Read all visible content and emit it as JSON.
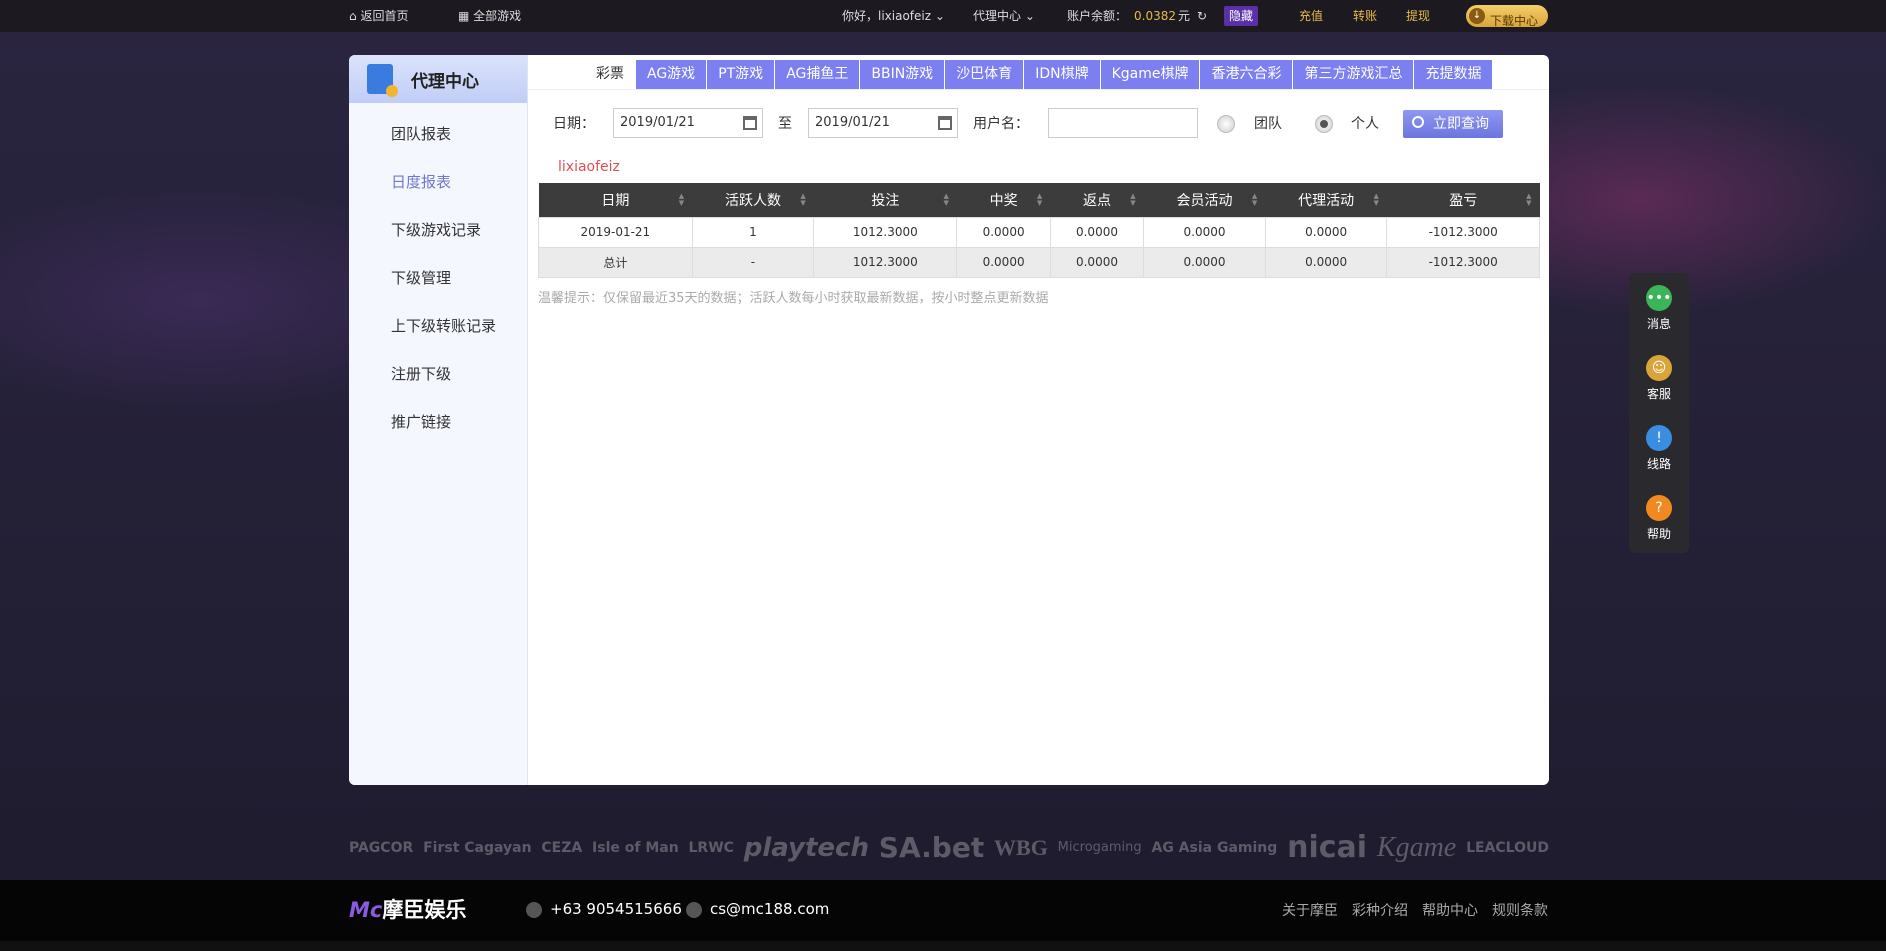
{
  "topbar": {
    "home": "返回首页",
    "all_games": "全部游戏",
    "greeting": "你好，lixiaofeiz",
    "agent_center": "代理中心",
    "balance_label": "账户余额：",
    "balance": "0.0382",
    "currency": "元",
    "hide": "隐藏",
    "deposit": "充值",
    "transfer": "转账",
    "withdraw": "提现",
    "download": "下载中心"
  },
  "sidebar": {
    "title": "代理中心",
    "items": [
      "团队报表",
      "日度报表",
      "下级游戏记录",
      "下级管理",
      "上下级转账记录",
      "注册下级",
      "推广链接"
    ]
  },
  "tabs": [
    "彩票",
    "AG游戏",
    "PT游戏",
    "AG捕鱼王",
    "BBIN游戏",
    "沙巴体育",
    "IDN棋牌",
    "Kgame棋牌",
    "香港六合彩",
    "第三方游戏汇总",
    "充提数据"
  ],
  "form": {
    "date_label": "日期：",
    "start": "2019/01/21",
    "to": "至",
    "end": "2019/01/21",
    "user_label": "用户名：",
    "user_value": "",
    "team": "团队",
    "personal": "个人",
    "query": "立即查询"
  },
  "username": "lixiaofeiz",
  "table": {
    "headers": [
      "日期",
      "活跃人数",
      "投注",
      "中奖",
      "返点",
      "会员活动",
      "代理活动",
      "盈亏"
    ],
    "rows": [
      [
        "2019-01-21",
        "1",
        "1012.3000",
        "0.0000",
        "0.0000",
        "0.0000",
        "0.0000",
        "-1012.3000"
      ],
      [
        "总计",
        "-",
        "1012.3000",
        "0.0000",
        "0.0000",
        "0.0000",
        "0.0000",
        "-1012.3000"
      ]
    ]
  },
  "hint": "温馨提示：仅保留最近35天的数据；活跃人数每小时获取最新数据，按小时整点更新数据",
  "float": [
    "消息",
    "客服",
    "线路",
    "帮助"
  ],
  "partners": [
    "PAGCOR",
    "First Cagayan",
    "CEZA",
    "Isle of Man",
    "LRWC",
    "playtech",
    "SA.bet",
    "WBG",
    "Microgaming",
    "AG Asia Gaming",
    "nicai",
    "Kgame",
    "LEACLOUD"
  ],
  "footer": {
    "brand": "摩臣娱乐",
    "logo_mark": "Mc",
    "phone": "+63 9054515666",
    "email": "cs@mc188.com",
    "links": [
      "关于摩臣",
      "彩种介绍",
      "帮助中心",
      "规则条款"
    ]
  }
}
